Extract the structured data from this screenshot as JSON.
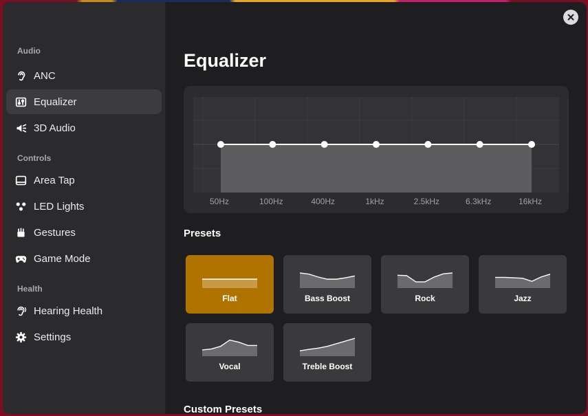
{
  "sidebar": {
    "sections": [
      {
        "title": "Audio",
        "items": [
          {
            "label": "ANC",
            "icon": "ear-icon"
          },
          {
            "label": "Equalizer",
            "icon": "equalizer-icon",
            "active": true
          },
          {
            "label": "3D Audio",
            "icon": "speaker-icon"
          }
        ]
      },
      {
        "title": "Controls",
        "items": [
          {
            "label": "Area Tap",
            "icon": "touchpad-icon"
          },
          {
            "label": "LED Lights",
            "icon": "led-icon"
          },
          {
            "label": "Gestures",
            "icon": "gestures-icon"
          },
          {
            "label": "Game Mode",
            "icon": "gamepad-icon"
          }
        ]
      },
      {
        "title": "Health",
        "items": [
          {
            "label": "Hearing Health",
            "icon": "hearing-icon"
          },
          {
            "label": "Settings",
            "icon": "gear-icon"
          }
        ]
      }
    ]
  },
  "main": {
    "title": "Equalizer",
    "eq": {
      "bands": [
        "50Hz",
        "100Hz",
        "400Hz",
        "1kHz",
        "2.5kHz",
        "6.3kHz",
        "16kHz"
      ],
      "gains": [
        0,
        0,
        0,
        0,
        0,
        0,
        0
      ],
      "range": [
        -1,
        1
      ]
    },
    "presets_title": "Presets",
    "presets": [
      {
        "label": "Flat",
        "active": true,
        "curve": [
          0.5,
          0.5,
          0.5,
          0.5,
          0.5,
          0.5,
          0.5
        ]
      },
      {
        "label": "Bass Boost",
        "curve": [
          0.85,
          0.78,
          0.62,
          0.5,
          0.5,
          0.58,
          0.68
        ]
      },
      {
        "label": "Rock",
        "curve": [
          0.72,
          0.7,
          0.35,
          0.35,
          0.62,
          0.8,
          0.85
        ]
      },
      {
        "label": "Jazz",
        "curve": [
          0.6,
          0.6,
          0.58,
          0.55,
          0.38,
          0.62,
          0.78
        ]
      },
      {
        "label": "Vocal",
        "curve": [
          0.35,
          0.4,
          0.55,
          0.9,
          0.78,
          0.6,
          0.6
        ]
      },
      {
        "label": "Treble Boost",
        "curve": [
          0.3,
          0.38,
          0.45,
          0.55,
          0.7,
          0.85,
          1.0
        ]
      }
    ],
    "custom_title": "Custom Presets"
  },
  "colors": {
    "accent": "#b07300",
    "sidebar_bg": "#2b2b2e",
    "main_bg": "#1e1e20"
  }
}
